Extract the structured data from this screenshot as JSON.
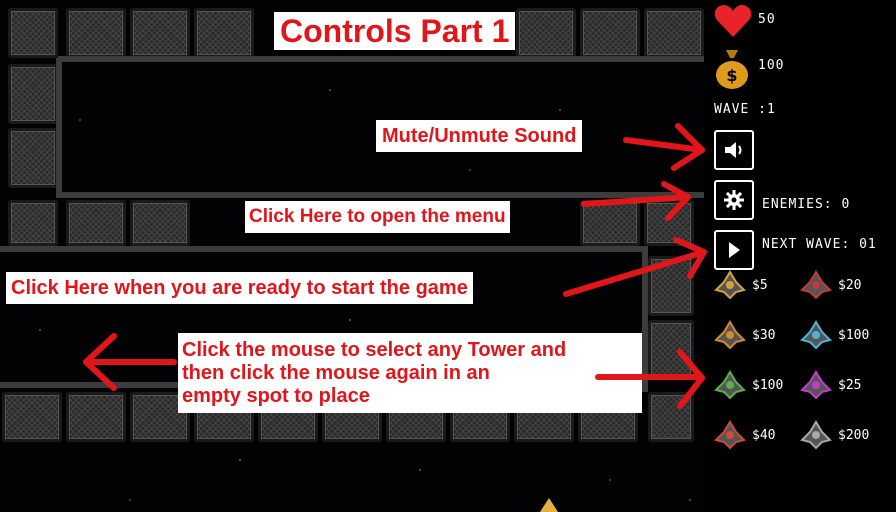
{
  "hud": {
    "lives": "50",
    "money": "100",
    "wave": "WAVE :1",
    "enemies": "ENEMIES: 0",
    "next_wave": "NEXT WAVE: 01"
  },
  "shop": {
    "towers": [
      {
        "price": "$5",
        "color": "#d8a23a"
      },
      {
        "price": "$20",
        "color": "#c43a3a"
      },
      {
        "price": "$30",
        "color": "#d28a2a"
      },
      {
        "price": "$100",
        "color": "#4ab6d8"
      },
      {
        "price": "$100",
        "color": "#5ab04a"
      },
      {
        "price": "$25",
        "color": "#c23cc8"
      },
      {
        "price": "$40",
        "color": "#d04a3a"
      },
      {
        "price": "$200",
        "color": "#a8a8a8"
      }
    ]
  },
  "tutorial": {
    "title": "Controls Part 1",
    "mute_hint": "Mute/Unmute Sound",
    "menu_hint": "Click Here to open the menu",
    "start_hint": "Click Here when you are ready to start the game",
    "tower_hint_line1": "Click the mouse to select any Tower and",
    "tower_hint_line2": "then click the mouse again in an",
    "tower_hint_line3": "empty spot to place"
  },
  "colors": {
    "accent_red": "#e0161b",
    "heart": "#e8242a",
    "money_bag": "#e09a1c"
  },
  "icons": [
    "heart-icon",
    "money-bag-icon",
    "speaker-icon",
    "gear-icon",
    "play-icon"
  ]
}
